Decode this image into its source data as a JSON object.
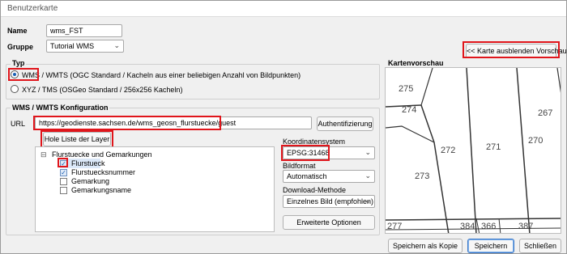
{
  "window": {
    "title": "Benutzerkarte"
  },
  "form": {
    "name_label": "Name",
    "name_value": "wms_FST",
    "group_label": "Gruppe",
    "group_value": "Tutorial WMS"
  },
  "hide_preview_label": "<< Karte ausblenden Vorschau",
  "typ": {
    "title": "Typ",
    "wms_option": "WMS / WMTS (OGC Standard / Kacheln aus einer beliebigen Anzahl von Bildpunkten)",
    "xyz_option": "XYZ / TMS (OSGeo Standard / 256x256 Kacheln)",
    "selected": "wms"
  },
  "wms_config": {
    "title": "WMS / WMTS Konfiguration",
    "url_label": "URL",
    "url_value": "https://geodienste.sachsen.de/wms_geosn_flurstuecke/guest",
    "auth_button": "Authentifizierung",
    "fetch_layers_button": "Hole Liste der Layer",
    "layers": {
      "root": "Flurstuecke und Gemarkungen",
      "root_toggle": "⊟",
      "children": [
        {
          "label": "Flurstueck",
          "checked": true
        },
        {
          "label": "Flurstuecksnummer",
          "checked": true
        },
        {
          "label": "Gemarkung",
          "checked": false
        },
        {
          "label": "Gemarkungsname",
          "checked": false
        }
      ]
    },
    "crs_label": "Koordinatensystem",
    "crs_value": "EPSG:31468",
    "format_label": "Bildformat",
    "format_value": "Automatisch",
    "download_label": "Download-Methode",
    "download_value": "Einzelnes Bild (empfohlen)",
    "advanced_button": "Erweiterte Optionen"
  },
  "preview": {
    "title": "Kartenvorschau",
    "parcel_labels": [
      "275",
      "274",
      "267",
      "272",
      "271",
      "270",
      "273",
      "277",
      "384",
      "366",
      "387"
    ]
  },
  "footer": {
    "save_copy": "Speichern als Kopie",
    "save": "Speichern",
    "close": "Schließen"
  },
  "colors": {
    "highlight": "#e0151b",
    "accent": "#1a5fb4"
  },
  "icons": {
    "chevron": "chevron-down-icon",
    "check": "check-icon"
  }
}
